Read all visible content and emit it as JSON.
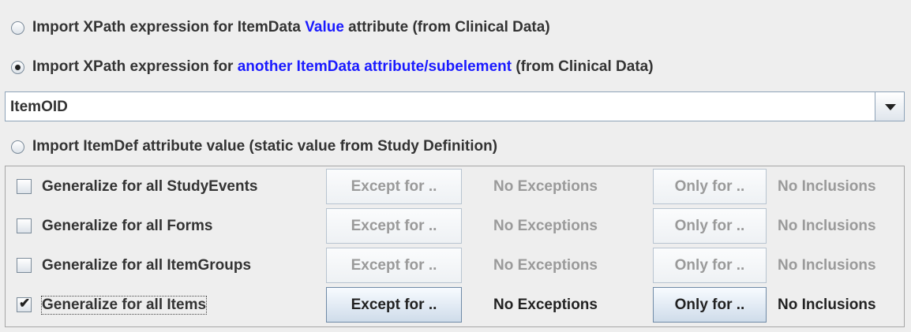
{
  "import_options": {
    "value_option": {
      "before": "Import XPath expression for ItemData ",
      "highlight": "Value",
      "after": " attribute (from Clinical Data)",
      "selected": false
    },
    "attribute_option": {
      "before": "Import XPath expression for ",
      "highlight": "another ItemData attribute/subelement",
      "after": " (from Clinical Data)",
      "selected": true
    },
    "attribute_select": {
      "value": "ItemOID"
    },
    "itemdef_option": {
      "label": "Import ItemDef attribute value (static value from Study Definition)",
      "selected": false
    }
  },
  "generalize": [
    {
      "label": "Generalize for all StudyEvents",
      "checked": false,
      "except_label": "Except for ..",
      "exceptions_text": "No Exceptions",
      "only_label": "Only for ..",
      "inclusions_text": "No Inclusions",
      "enabled": false
    },
    {
      "label": "Generalize for all Forms",
      "checked": false,
      "except_label": "Except for ..",
      "exceptions_text": "No Exceptions",
      "only_label": "Only for ..",
      "inclusions_text": "No Inclusions",
      "enabled": false
    },
    {
      "label": "Generalize for all ItemGroups",
      "checked": false,
      "except_label": "Except for ..",
      "exceptions_text": "No Exceptions",
      "only_label": "Only for ..",
      "inclusions_text": "No Inclusions",
      "enabled": false
    },
    {
      "label": "Generalize for all Items",
      "checked": true,
      "except_label": "Except for ..",
      "exceptions_text": "No Exceptions",
      "only_label": "Only for ..",
      "inclusions_text": "No Inclusions",
      "enabled": true
    }
  ],
  "colors": {
    "highlight": "#1a1aff",
    "disabled_text": "#9a9a9a",
    "background": "#eeeeee"
  }
}
